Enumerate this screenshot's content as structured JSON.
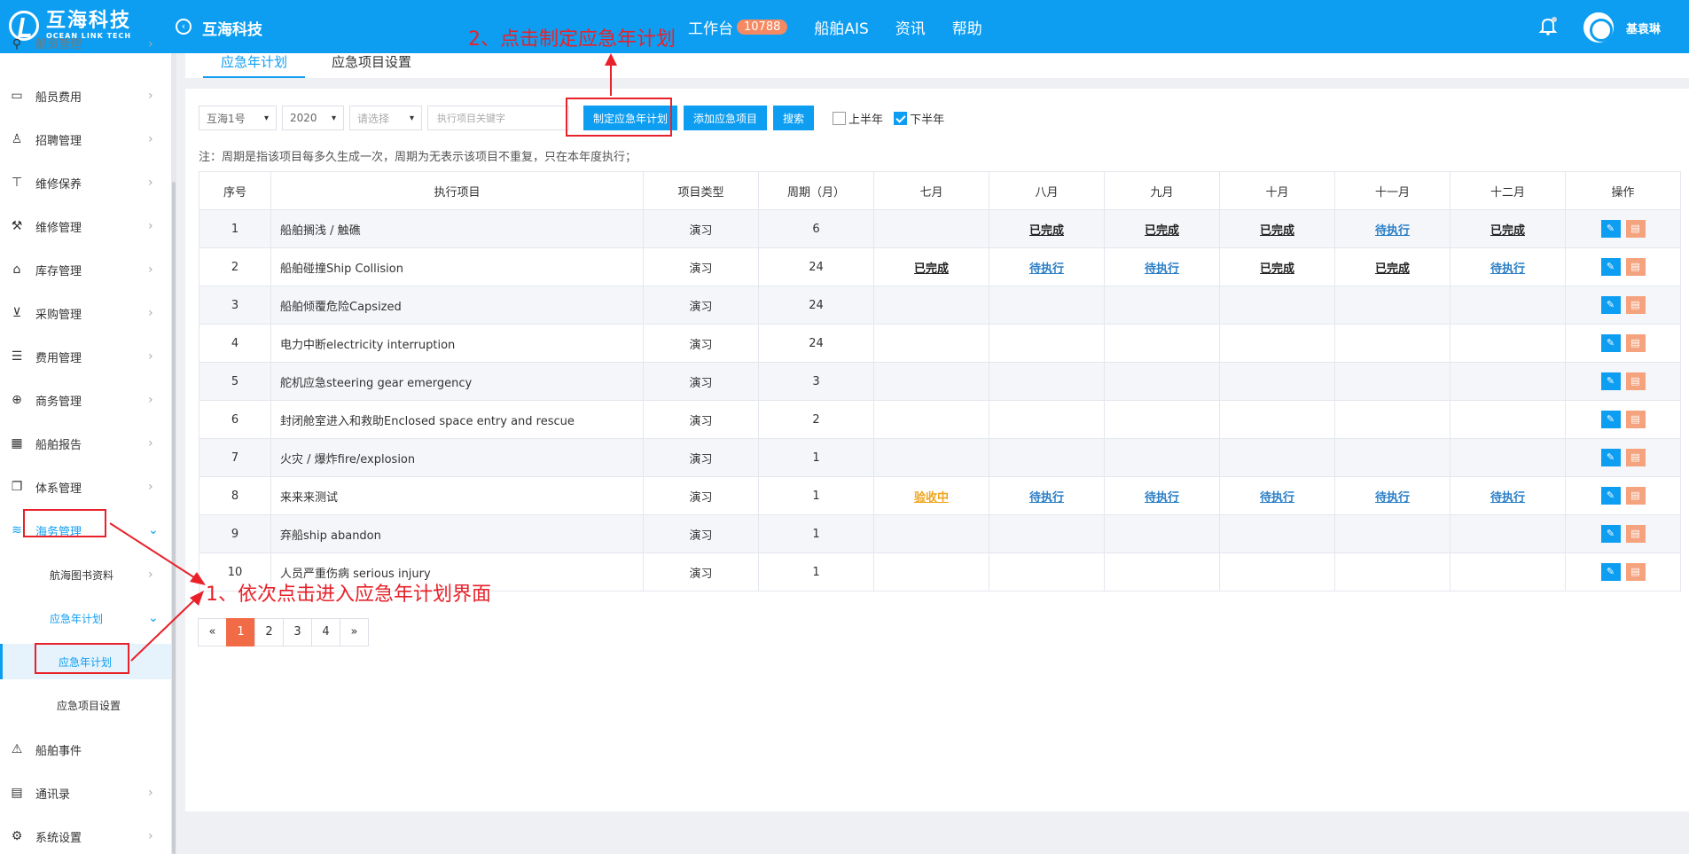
{
  "header": {
    "logo_cn": "互海科技",
    "logo_en": "OCEAN LINK TECH",
    "title": "互海科技",
    "nav": [
      {
        "label": "工作台",
        "badge": "10788"
      },
      {
        "label": "船舶AIS"
      },
      {
        "label": "资讯"
      },
      {
        "label": "帮助"
      }
    ],
    "user": "基袁琳"
  },
  "sidebar": {
    "items": [
      {
        "label": "船员管理",
        "icon": "person-icon"
      },
      {
        "label": "船员费用",
        "icon": "wallet-icon"
      },
      {
        "label": "招聘管理",
        "icon": "person-search-icon"
      },
      {
        "label": "维修保养",
        "icon": "tool-icon"
      },
      {
        "label": "维修管理",
        "icon": "wrench-icon"
      },
      {
        "label": "库存管理",
        "icon": "warehouse-icon"
      },
      {
        "label": "采购管理",
        "icon": "cart-icon"
      },
      {
        "label": "费用管理",
        "icon": "database-icon"
      },
      {
        "label": "商务管理",
        "icon": "globe-icon"
      },
      {
        "label": "船舶报告",
        "icon": "calendar-icon"
      },
      {
        "label": "体系管理",
        "icon": "document-icon"
      },
      {
        "label": "海务管理",
        "icon": "sea-icon"
      }
    ],
    "sub_items": {
      "library": "航海图书资料",
      "group": "应急年计划",
      "active": "应急年计划",
      "settings": "应急项目设置"
    },
    "bottom_items": [
      {
        "label": "船舶事件",
        "icon": "warning-icon"
      },
      {
        "label": "通讯录",
        "icon": "contacts-icon"
      },
      {
        "label": "系统设置",
        "icon": "gear-icon"
      }
    ]
  },
  "tabs": [
    {
      "label": "应急年计划",
      "active": true
    },
    {
      "label": "应急项目设置",
      "active": false
    }
  ],
  "toolbar": {
    "ship": "互海1号",
    "year": "2020",
    "select_placeholder": "请选择",
    "keyword_placeholder": "执行项目关键字",
    "btn_plan": "制定应急年计划",
    "btn_add": "添加应急项目",
    "btn_search": "搜索",
    "chk_first": "上半年",
    "chk_second": "下半年",
    "chk_first_checked": false,
    "chk_second_checked": true
  },
  "note": "注：周期是指该项目每多久生成一次，周期为无表示该项目不重复，只在本年度执行；",
  "table": {
    "headers": [
      "序号",
      "执行项目",
      "项目类型",
      "周期（月）",
      "七月",
      "八月",
      "九月",
      "十月",
      "十一月",
      "十二月",
      "操作"
    ],
    "rows": [
      {
        "no": "1",
        "item": "船舶搁浅 / 触礁",
        "type": "演习",
        "cycle": "6",
        "months": [
          "",
          "已完成",
          "已完成",
          "已完成",
          "待执行",
          "已完成"
        ]
      },
      {
        "no": "2",
        "item": "船舶碰撞Ship Collision",
        "type": "演习",
        "cycle": "24",
        "months": [
          "已完成",
          "待执行",
          "待执行",
          "已完成",
          "已完成",
          "待执行"
        ]
      },
      {
        "no": "3",
        "item": "船舶倾覆危险Capsized",
        "type": "演习",
        "cycle": "24",
        "months": [
          "",
          "",
          "",
          "",
          "",
          ""
        ]
      },
      {
        "no": "4",
        "item": "电力中断electricity interruption",
        "type": "演习",
        "cycle": "24",
        "months": [
          "",
          "",
          "",
          "",
          "",
          ""
        ]
      },
      {
        "no": "5",
        "item": "舵机应急steering gear emergency",
        "type": "演习",
        "cycle": "3",
        "months": [
          "",
          "",
          "",
          "",
          "",
          ""
        ]
      },
      {
        "no": "6",
        "item": "封闭舱室进入和救助Enclosed space entry and rescue",
        "type": "演习",
        "cycle": "2",
        "months": [
          "",
          "",
          "",
          "",
          "",
          ""
        ]
      },
      {
        "no": "7",
        "item": "火灾 / 爆炸fire/explosion",
        "type": "演习",
        "cycle": "1",
        "months": [
          "",
          "",
          "",
          "",
          "",
          ""
        ]
      },
      {
        "no": "8",
        "item": "来来来测试",
        "type": "演习",
        "cycle": "1",
        "months": [
          "验收中",
          "待执行",
          "待执行",
          "待执行",
          "待执行",
          "待执行"
        ]
      },
      {
        "no": "9",
        "item": "弃船ship abandon",
        "type": "演习",
        "cycle": "1",
        "months": [
          "",
          "",
          "",
          "",
          "",
          ""
        ]
      },
      {
        "no": "10",
        "item": "人员严重伤病 serious injury",
        "type": "演习",
        "cycle": "1",
        "months": [
          "",
          "",
          "",
          "",
          "",
          ""
        ]
      }
    ]
  },
  "pagination": {
    "prev": "«",
    "pages": [
      "1",
      "2",
      "3",
      "4"
    ],
    "current": "1",
    "next": "»"
  },
  "annotations": {
    "step1": "1、依次点击进入应急年计划界面",
    "step2": "2、点击制定应急年计划"
  },
  "colors": {
    "brand": "#0d9ef2",
    "accent": "#f26b47",
    "annotation": "#e8212a",
    "pending": "#2a7ec6",
    "accepting": "#f0a51e"
  }
}
